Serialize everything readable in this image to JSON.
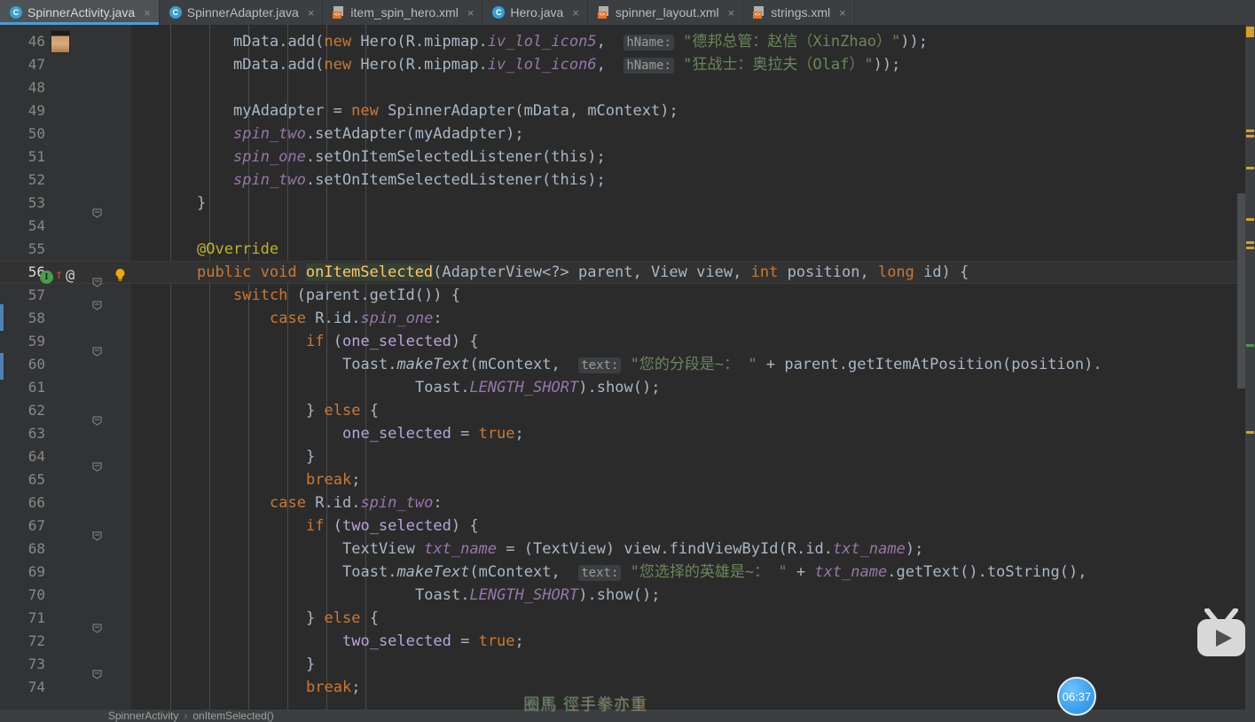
{
  "window": {
    "app": "Android Studio IDE code editor",
    "theme_background": "#2b2b2b",
    "accent": "#4a9fd8"
  },
  "tabs": [
    {
      "label": "SpinnerActivity.java",
      "icon": "java-class-icon",
      "active": true,
      "close": "×"
    },
    {
      "label": "SpinnerAdapter.java",
      "icon": "java-class-icon",
      "active": false,
      "close": "×"
    },
    {
      "label": "item_spin_hero.xml",
      "icon": "xml-file-icon",
      "active": false,
      "close": "×"
    },
    {
      "label": "Hero.java",
      "icon": "java-class-icon",
      "active": false,
      "close": "×"
    },
    {
      "label": "spinner_layout.xml",
      "icon": "xml-file-icon",
      "active": false,
      "close": "×"
    },
    {
      "label": "strings.xml",
      "icon": "xml-file-icon",
      "active": false,
      "close": "×"
    }
  ],
  "editor": {
    "first_visible_line": 46,
    "last_visible_line": 74,
    "current_line": 56,
    "selected_token": "onItemSelected",
    "line_numbers": [
      46,
      47,
      48,
      49,
      50,
      51,
      52,
      53,
      54,
      55,
      56,
      57,
      58,
      59,
      60,
      61,
      62,
      63,
      64,
      65,
      66,
      67,
      68,
      69,
      70,
      71,
      72,
      73,
      74
    ],
    "lines": [
      {
        "n": 46,
        "text": "            mData.add(new Hero(R.mipmap.iv_lol_icon5,  hName: \"德邦总管：赵信（XinZhao）\"));"
      },
      {
        "n": 47,
        "text": "            mData.add(new Hero(R.mipmap.iv_lol_icon6,  hName: \"狂战士：奥拉夫（Olaf）\"));"
      },
      {
        "n": 48,
        "text": ""
      },
      {
        "n": 49,
        "text": "            myAdadpter = new SpinnerAdapter(mData, mContext);"
      },
      {
        "n": 50,
        "text": "            spin_two.setAdapter(myAdadpter);"
      },
      {
        "n": 51,
        "text": "            spin_one.setOnItemSelectedListener(this);"
      },
      {
        "n": 52,
        "text": "            spin_two.setOnItemSelectedListener(this);"
      },
      {
        "n": 53,
        "text": "        }"
      },
      {
        "n": 54,
        "text": ""
      },
      {
        "n": 55,
        "text": "        @Override"
      },
      {
        "n": 56,
        "text": "        public void onItemSelected(AdapterView<?> parent, View view, int position, long id) {"
      },
      {
        "n": 57,
        "text": "            switch (parent.getId()) {"
      },
      {
        "n": 58,
        "text": "                case R.id.spin_one:"
      },
      {
        "n": 59,
        "text": "                    if (one_selected) {"
      },
      {
        "n": 60,
        "text": "                        Toast.makeText(mContext,  text: \"您的分段是~： \" + parent.getItemAtPosition(position)."
      },
      {
        "n": 61,
        "text": "                                Toast.LENGTH_SHORT).show();"
      },
      {
        "n": 62,
        "text": "                    } else {"
      },
      {
        "n": 63,
        "text": "                        one_selected = true;"
      },
      {
        "n": 64,
        "text": "                    }"
      },
      {
        "n": 65,
        "text": "                    break;"
      },
      {
        "n": 66,
        "text": "                case R.id.spin_two:"
      },
      {
        "n": 67,
        "text": "                    if (two_selected) {"
      },
      {
        "n": 68,
        "text": "                        TextView txt_name = (TextView) view.findViewById(R.id.txt_name);"
      },
      {
        "n": 69,
        "text": "                        Toast.makeText(mContext,  text: \"您选择的英雄是~： \" + txt_name.getText().toString(),"
      },
      {
        "n": 70,
        "text": "                                Toast.LENGTH_SHORT).show();"
      },
      {
        "n": 71,
        "text": "                    } else {"
      },
      {
        "n": 72,
        "text": "                        two_selected = true;"
      },
      {
        "n": 73,
        "text": "                    }"
      },
      {
        "n": 74,
        "text": "                    break;"
      }
    ],
    "parameter_hints": [
      "hName:",
      "text:"
    ],
    "gutter_icons": {
      "line56": [
        "implements-method-icon",
        "override-arrow-icon",
        "annotation-at-icon",
        "fold-icon",
        "intention-bulb-icon"
      ],
      "line46": "author-avatar-icon"
    }
  },
  "breadcrumb": {
    "class": "SpinnerActivity",
    "separator": "›",
    "method": "onItemSelected()"
  },
  "overlays": {
    "watermark": "圈馬 徑手拳亦重",
    "player_logo": "bilibili-tv-logo-icon",
    "timer_label": "06:37"
  },
  "syntax_colors": {
    "keyword": "#cc7832",
    "string": "#6a8759",
    "annotation": "#bbb529",
    "static_field": "#9876aa",
    "method_decl": "#ffc66d",
    "default_text": "#a9b7c6",
    "hint_chip": "#9a9a9a"
  }
}
